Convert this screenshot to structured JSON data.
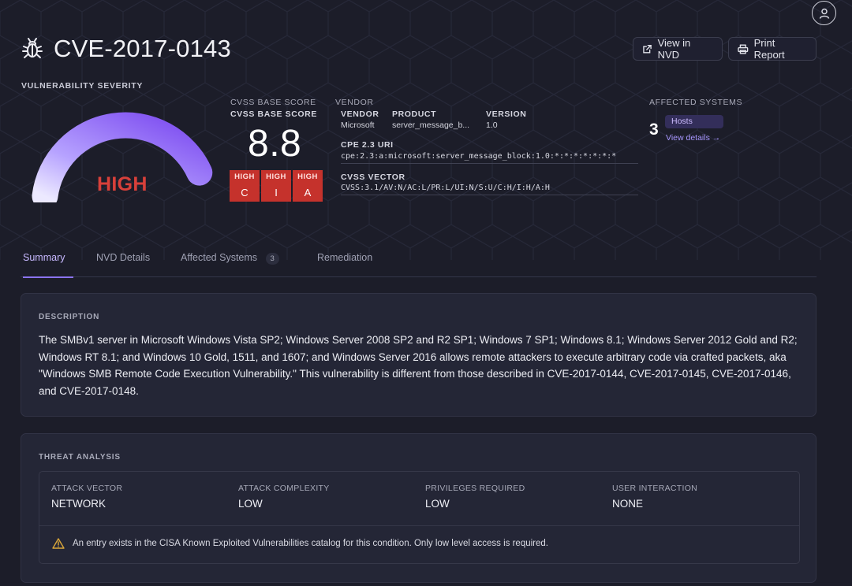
{
  "header": {
    "cve_id": "CVE-2017-0143",
    "view_nvd_label": "View in NVD",
    "print_report_label": "Print Report"
  },
  "severity": {
    "section_label": "VULNERABILITY SEVERITY",
    "level": "HIGH",
    "gauge_fraction": 0.88
  },
  "cvss": {
    "label_small": "CVSS BASE SCORE",
    "label": "CVSS BASE SCORE",
    "score": "8.8",
    "cia": [
      {
        "level": "HIGH",
        "letter": "C"
      },
      {
        "level": "HIGH",
        "letter": "I"
      },
      {
        "level": "HIGH",
        "letter": "A"
      }
    ]
  },
  "meta": {
    "vendor_small": "VENDOR",
    "vendor_head": "VENDOR",
    "vendor_value": "Microsoft",
    "product_head": "PRODUCT",
    "product_value": "server_message_b...",
    "version_head": "VERSION",
    "version_value": "1.0",
    "cpe_head": "CPE 2.3 URI",
    "cpe_value": "cpe:2.3:a:microsoft:server_message_block:1.0:*:*:*:*:*:*:*",
    "vector_head": "CVSS VECTOR",
    "vector_value": "CVSS:3.1/AV:N/AC:L/PR:L/UI:N/S:U/C:H/I:H/A:H"
  },
  "affected": {
    "label": "AFFECTED SYSTEMS",
    "count": "3",
    "badge": "Hosts",
    "view_details": "View details →"
  },
  "tabs": [
    {
      "label": "Summary",
      "active": true
    },
    {
      "label": "NVD Details"
    },
    {
      "label": "Affected Systems",
      "badge": "3"
    },
    {
      "label": "Remediation"
    }
  ],
  "description": {
    "label": "DESCRIPTION",
    "text": "The SMBv1 server in Microsoft Windows Vista SP2; Windows Server 2008 SP2 and R2 SP1; Windows 7 SP1; Windows 8.1; Windows Server 2012 Gold and R2; Windows RT 8.1; and Windows 10 Gold, 1511, and 1607; and Windows Server 2016 allows remote attackers to execute arbitrary code via crafted packets, aka \"Windows SMB Remote Code Execution Vulnerability.\" This vulnerability is different from those described in CVE-2017-0144, CVE-2017-0145, CVE-2017-0146, and CVE-2017-0148."
  },
  "threat": {
    "label": "THREAT ANALYSIS",
    "items": [
      {
        "head": "ATTACK VECTOR",
        "value": "NETWORK"
      },
      {
        "head": "ATTACK COMPLEXITY",
        "value": "LOW"
      },
      {
        "head": "PRIVILEGES REQUIRED",
        "value": "LOW"
      },
      {
        "head": "USER INTERACTION",
        "value": "NONE"
      }
    ],
    "warning": "An entry exists in the CISA Known Exploited Vulnerabilities catalog for this condition. Only low level access is required."
  },
  "colors": {
    "background": "#1c1d29",
    "severity_red": "#d8403a",
    "accent_purple": "#8b74f0",
    "warning_yellow": "#d9a63a"
  }
}
